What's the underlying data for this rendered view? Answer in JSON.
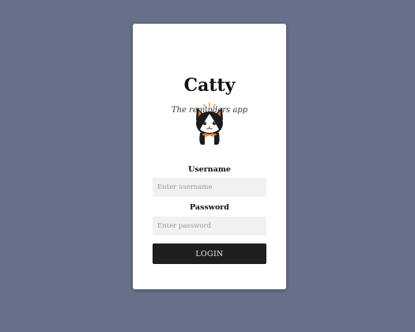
{
  "app": {
    "title": "Catty",
    "subtitle": "The reminders app",
    "logo_icon": "cat-mascot-icon"
  },
  "form": {
    "username_label": "Username",
    "username_placeholder": "Enter username",
    "username_value": "",
    "password_label": "Password",
    "password_placeholder": "Enter password",
    "password_value": "",
    "login_label": "LOGIN"
  },
  "colors": {
    "background": "#657089",
    "card": "#ffffff",
    "input_bg": "#f1f1f1",
    "button_bg": "#1f1f1f",
    "button_text": "#e8e8e8",
    "accent_orange": "#e8782e"
  }
}
